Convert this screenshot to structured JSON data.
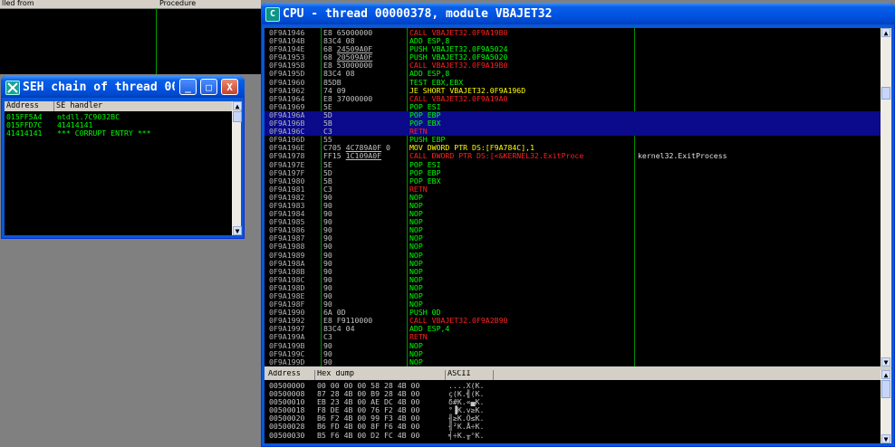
{
  "back": {
    "col1": "lled from",
    "col2": "Procedure"
  },
  "seh": {
    "title": "SEH chain of thread 000...",
    "columns": [
      "Address",
      "SE handler"
    ],
    "rows": [
      {
        "address": "015FF5A4",
        "handler": "ntdll.7C9032BC"
      },
      {
        "address": "015FFD7C",
        "handler": "41414141"
      },
      {
        "address": "41414141",
        "handler": "*** CORRUPT ENTRY ***"
      }
    ],
    "buttons": {
      "minimize": "_",
      "maximize": "□",
      "close": "X"
    }
  },
  "cpu": {
    "title": "CPU - thread 00000378, module VBAJET32",
    "icon_letter": "C",
    "buttons": {
      "minimize": "_",
      "maximize": "□",
      "close": "X"
    },
    "scroll": {
      "up": "▲",
      "down": "▼"
    },
    "disasm": [
      {
        "a": "0F9A1946",
        "h": "E8 65000000",
        "i": "CALL VBAJET32.0F9A19B0",
        "c": "red"
      },
      {
        "a": "0F9A194B",
        "h": "83C4 08",
        "i": "ADD ESP,8",
        "c": "green"
      },
      {
        "a": "0F9A194E",
        "h": "68 24509A0F",
        "i": "PUSH VBAJET32.0F9A5024",
        "c": "green",
        "hu": true
      },
      {
        "a": "0F9A1953",
        "h": "68 20509A0F",
        "i": "PUSH VBAJET32.0F9A5020",
        "c": "green",
        "hu": true
      },
      {
        "a": "0F9A1958",
        "h": "E8 53000000",
        "i": "CALL VBAJET32.0F9A19B0",
        "c": "red"
      },
      {
        "a": "0F9A195D",
        "h": "83C4 08",
        "i": "ADD ESP,8",
        "c": "green"
      },
      {
        "a": "0F9A1960",
        "h": "85DB",
        "i": "TEST EBX,EBX",
        "c": "green"
      },
      {
        "a": "0F9A1962",
        "h": "74 09",
        "i": "JE SHORT VBAJET32.0F9A196D",
        "c": "yellow"
      },
      {
        "a": "0F9A1964",
        "h": "E8 37000000",
        "i": "CALL VBAJET32.0F9A19A0",
        "c": "red"
      },
      {
        "a": "0F9A1969",
        "h": "5E",
        "i": "POP ESI",
        "c": "green"
      },
      {
        "a": "0F9A196A",
        "h": "5D",
        "i": "POP EBP",
        "c": "green",
        "sel": true
      },
      {
        "a": "0F9A196B",
        "h": "5B",
        "i": "POP EBX",
        "c": "green",
        "sel": true
      },
      {
        "a": "0F9A196C",
        "h": "C3",
        "i": "RETN",
        "c": "red",
        "sel": true
      },
      {
        "a": "0F9A196D",
        "h": "55",
        "i": "PUSH EBP",
        "c": "green"
      },
      {
        "a": "0F9A196E",
        "h": "C705 4C789A0F 0",
        "i": "MOV DWORD PTR DS:[F9A784C],1",
        "c": "yellow",
        "hu": true
      },
      {
        "a": "0F9A1978",
        "h": "FF15 1C109A0F",
        "i": "CALL DWORD PTR DS:[<&KERNEL32.ExitProce",
        "c": "red",
        "hu": true,
        "cm": "kernel32.ExitProcess"
      },
      {
        "a": "0F9A197E",
        "h": "5E",
        "i": "POP ESI",
        "c": "green"
      },
      {
        "a": "0F9A197F",
        "h": "5D",
        "i": "POP EBP",
        "c": "green"
      },
      {
        "a": "0F9A1980",
        "h": "5B",
        "i": "POP EBX",
        "c": "green"
      },
      {
        "a": "0F9A1981",
        "h": "C3",
        "i": "RETN",
        "c": "red"
      },
      {
        "a": "0F9A1982",
        "h": "90",
        "i": "NOP",
        "c": "green"
      },
      {
        "a": "0F9A1983",
        "h": "90",
        "i": "NOP",
        "c": "green"
      },
      {
        "a": "0F9A1984",
        "h": "90",
        "i": "NOP",
        "c": "green"
      },
      {
        "a": "0F9A1985",
        "h": "90",
        "i": "NOP",
        "c": "green"
      },
      {
        "a": "0F9A1986",
        "h": "90",
        "i": "NOP",
        "c": "green"
      },
      {
        "a": "0F9A1987",
        "h": "90",
        "i": "NOP",
        "c": "green"
      },
      {
        "a": "0F9A1988",
        "h": "90",
        "i": "NOP",
        "c": "green"
      },
      {
        "a": "0F9A1989",
        "h": "90",
        "i": "NOP",
        "c": "green"
      },
      {
        "a": "0F9A198A",
        "h": "90",
        "i": "NOP",
        "c": "green"
      },
      {
        "a": "0F9A198B",
        "h": "90",
        "i": "NOP",
        "c": "green"
      },
      {
        "a": "0F9A198C",
        "h": "90",
        "i": "NOP",
        "c": "green"
      },
      {
        "a": "0F9A198D",
        "h": "90",
        "i": "NOP",
        "c": "green"
      },
      {
        "a": "0F9A198E",
        "h": "90",
        "i": "NOP",
        "c": "green"
      },
      {
        "a": "0F9A198F",
        "h": "90",
        "i": "NOP",
        "c": "green"
      },
      {
        "a": "0F9A1990",
        "h": "6A 0D",
        "i": "PUSH 0D",
        "c": "green"
      },
      {
        "a": "0F9A1992",
        "h": "E8 F9110000",
        "i": "CALL VBAJET32.0F9A2B90",
        "c": "red"
      },
      {
        "a": "0F9A1997",
        "h": "83C4 04",
        "i": "ADD ESP,4",
        "c": "green"
      },
      {
        "a": "0F9A199A",
        "h": "C3",
        "i": "RETN",
        "c": "red"
      },
      {
        "a": "0F9A199B",
        "h": "90",
        "i": "NOP",
        "c": "green"
      },
      {
        "a": "0F9A199C",
        "h": "90",
        "i": "NOP",
        "c": "green"
      },
      {
        "a": "0F9A199D",
        "h": "90",
        "i": "NOP",
        "c": "green"
      }
    ],
    "dump": {
      "columns": [
        "Address",
        "Hex dump",
        "ASCII"
      ],
      "rows": [
        {
          "a": "00500000",
          "h": "00 00 00 00 58 28 4B 00",
          "s": "....X(K."
        },
        {
          "a": "00500008",
          "h": "87 28 4B 00 B9 28 4B 00",
          "s": "ç(K.╣(K."
        },
        {
          "a": "00500010",
          "h": "EB 23 4B 00 AE DC 4B 00",
          "s": "δ#K.«▄K."
        },
        {
          "a": "00500018",
          "h": "F8 DE 4B 00 76 F2 4B 00",
          "s": "°▐K.v≥K."
        },
        {
          "a": "00500020",
          "h": "B6 F2 4B 00 99 F3 4B 00",
          "s": "╢≥K.Ö≤K."
        },
        {
          "a": "00500028",
          "h": "B6 FD 4B 00 8F F6 4B 00",
          "s": "╢²K.Å÷K."
        },
        {
          "a": "00500030",
          "h": "B5 F6 4B 00 D2 FC 4B 00",
          "s": "╡÷K.╥ⁿK."
        }
      ]
    }
  }
}
